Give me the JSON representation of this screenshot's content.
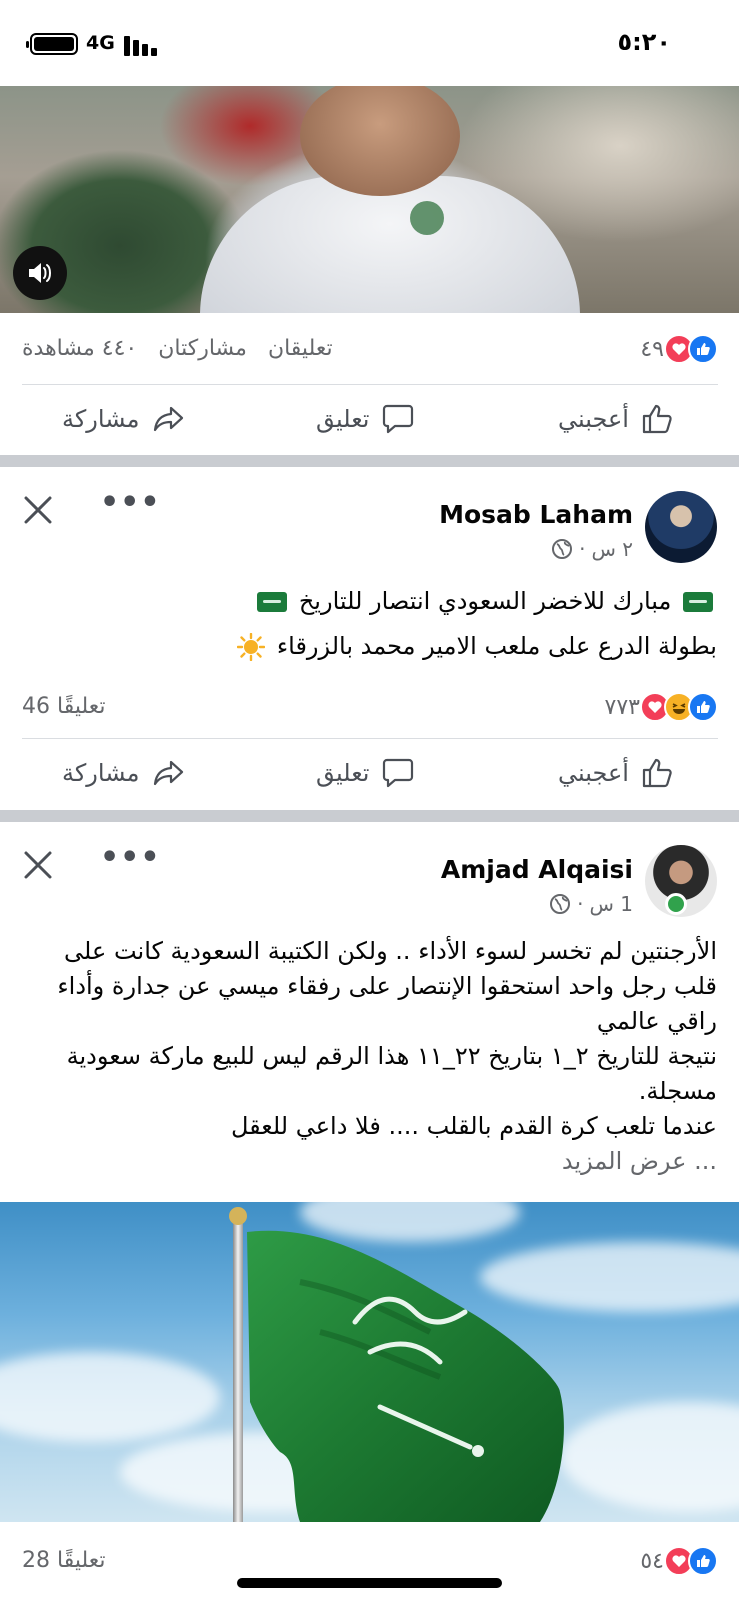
{
  "status_bar": {
    "time": "٥:٢٠",
    "network": "4G"
  },
  "post1": {
    "reaction_count": "٤٩",
    "views": "٤٤٠ مشاهدة",
    "shares": "مشاركتان",
    "comments": "تعليقان"
  },
  "actions": {
    "like": "أعجبني",
    "comment": "تعليق",
    "share": "مشاركة"
  },
  "post2": {
    "author": "Mosab Laham",
    "time": "٢ س",
    "line1": "مبارك للاخضر السعودي انتصار للتاريخ",
    "line2": "بطولة الدرع على ملعب الامير محمد بالزرقاء",
    "reaction_count": "٧٧٣",
    "comments": "46 تعليقًا"
  },
  "post3": {
    "author": "Amjad Alqaisi",
    "time": "1 س",
    "text1": "الأرجنتين لم تخسر لسوء الأداء .. ولكن الكتيبة السعودية كانت على قلب رجل واحد استحقوا الإنتصار على رفقاء ميسي عن جدارة وأداء راقي عالمي",
    "text2": "نتيجة للتاريخ ٢_١ بتاريخ ٢٢_١١ هذا الرقم ليس للبيع ماركة سعودية مسجلة.",
    "text3": "عندما تلعب كرة القدم بالقلب .... فلا داعي للعقل",
    "see_more": "... عرض المزيد",
    "reaction_count": "٥٤",
    "comments": "28 تعليقًا"
  },
  "colors": {
    "like_blue": "#1877f2",
    "love_red": "#f33e58",
    "haha_yellow": "#f7b125",
    "flag_green": "#1b7b3b"
  }
}
